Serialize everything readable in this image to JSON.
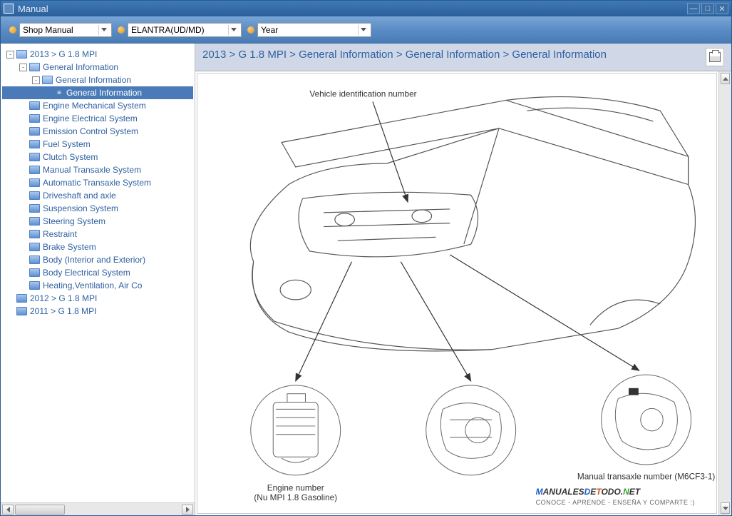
{
  "window": {
    "title": "Manual"
  },
  "toolbar": {
    "dropdowns": [
      {
        "label": "Shop Manual"
      },
      {
        "label": "ELANTRA(UD/MD)"
      },
      {
        "label": "Year"
      }
    ]
  },
  "tree": [
    {
      "level": 0,
      "expand": "-",
      "icon": "folder-open",
      "label": "2013 > G 1.8 MPI",
      "selected": false
    },
    {
      "level": 1,
      "expand": "-",
      "icon": "folder-open",
      "label": "General Information",
      "selected": false
    },
    {
      "level": 2,
      "expand": "-",
      "icon": "folder-open",
      "label": "General Information",
      "selected": false
    },
    {
      "level": 3,
      "expand": "",
      "icon": "doc",
      "label": "General Information",
      "selected": true
    },
    {
      "level": 1,
      "expand": "",
      "icon": "folder",
      "label": "Engine Mechanical System",
      "selected": false
    },
    {
      "level": 1,
      "expand": "",
      "icon": "folder",
      "label": "Engine Electrical System",
      "selected": false
    },
    {
      "level": 1,
      "expand": "",
      "icon": "folder",
      "label": "Emission Control System",
      "selected": false
    },
    {
      "level": 1,
      "expand": "",
      "icon": "folder",
      "label": "Fuel System",
      "selected": false
    },
    {
      "level": 1,
      "expand": "",
      "icon": "folder",
      "label": "Clutch System",
      "selected": false
    },
    {
      "level": 1,
      "expand": "",
      "icon": "folder",
      "label": "Manual Transaxle System",
      "selected": false
    },
    {
      "level": 1,
      "expand": "",
      "icon": "folder",
      "label": "Automatic Transaxle System",
      "selected": false
    },
    {
      "level": 1,
      "expand": "",
      "icon": "folder",
      "label": "Driveshaft and axle",
      "selected": false
    },
    {
      "level": 1,
      "expand": "",
      "icon": "folder",
      "label": "Suspension System",
      "selected": false
    },
    {
      "level": 1,
      "expand": "",
      "icon": "folder",
      "label": "Steering System",
      "selected": false
    },
    {
      "level": 1,
      "expand": "",
      "icon": "folder",
      "label": "Restraint",
      "selected": false
    },
    {
      "level": 1,
      "expand": "",
      "icon": "folder",
      "label": "Brake System",
      "selected": false
    },
    {
      "level": 1,
      "expand": "",
      "icon": "folder",
      "label": "Body (Interior and Exterior)",
      "selected": false
    },
    {
      "level": 1,
      "expand": "",
      "icon": "folder",
      "label": "Body Electrical System",
      "selected": false
    },
    {
      "level": 1,
      "expand": "",
      "icon": "folder",
      "label": "Heating,Ventilation, Air Co",
      "selected": false
    },
    {
      "level": 0,
      "expand": "",
      "icon": "folder",
      "label": "2012 > G 1.8 MPI",
      "selected": false
    },
    {
      "level": 0,
      "expand": "",
      "icon": "folder",
      "label": "2011 > G 1.8 MPI",
      "selected": false
    }
  ],
  "breadcrumb": "2013 > G 1.8 MPI > General Information > General Information > General Information",
  "diagram": {
    "labels": {
      "vin": "Vehicle identification number",
      "engine_line1": "Engine number",
      "engine_line2": "(Nu MPI 1.8 Gasoline)",
      "transaxle": "Manual transaxle number (M6CF3-1)"
    }
  },
  "watermark": {
    "text_parts": [
      "M",
      "ANUALES",
      "D",
      "E",
      "T",
      "ODO.",
      "N",
      "ET"
    ],
    "subtitle": "CONOCE - APRENDE - ENSEÑA Y COMPARTE :)"
  }
}
